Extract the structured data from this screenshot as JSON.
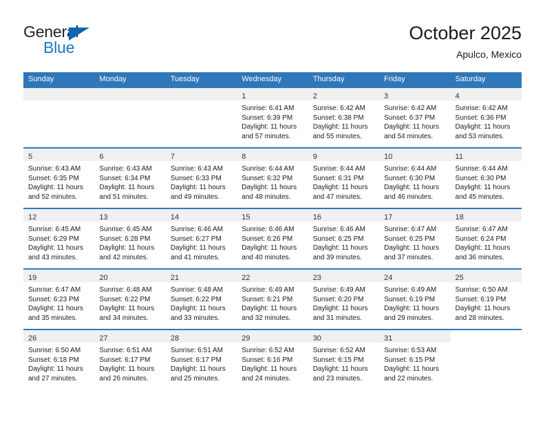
{
  "logo": {
    "word1": "General",
    "word2": "Blue",
    "triangle_color": "#0c68b4",
    "text_color": "#231f20",
    "blue_text_color": "#1878c8"
  },
  "header": {
    "title": "October 2025",
    "location": "Apulco, Mexico"
  },
  "theme": {
    "header_blue": "#2f77b8",
    "daynum_band": "#f0f0f0",
    "text": "#1a1a1a"
  },
  "weekdays": [
    "Sunday",
    "Monday",
    "Tuesday",
    "Wednesday",
    "Thursday",
    "Friday",
    "Saturday"
  ],
  "weeks": [
    [
      {
        "day": "",
        "sunrise": "",
        "sunset": "",
        "daylight1": "",
        "daylight2": "",
        "state": "empty"
      },
      {
        "day": "",
        "sunrise": "",
        "sunset": "",
        "daylight1": "",
        "daylight2": "",
        "state": "empty"
      },
      {
        "day": "",
        "sunrise": "",
        "sunset": "",
        "daylight1": "",
        "daylight2": "",
        "state": "empty"
      },
      {
        "day": "1",
        "sunrise": "Sunrise: 6:41 AM",
        "sunset": "Sunset: 6:39 PM",
        "daylight1": "Daylight: 11 hours",
        "daylight2": "and 57 minutes.",
        "state": "filled"
      },
      {
        "day": "2",
        "sunrise": "Sunrise: 6:42 AM",
        "sunset": "Sunset: 6:38 PM",
        "daylight1": "Daylight: 11 hours",
        "daylight2": "and 55 minutes.",
        "state": "filled"
      },
      {
        "day": "3",
        "sunrise": "Sunrise: 6:42 AM",
        "sunset": "Sunset: 6:37 PM",
        "daylight1": "Daylight: 11 hours",
        "daylight2": "and 54 minutes.",
        "state": "filled"
      },
      {
        "day": "4",
        "sunrise": "Sunrise: 6:42 AM",
        "sunset": "Sunset: 6:36 PM",
        "daylight1": "Daylight: 11 hours",
        "daylight2": "and 53 minutes.",
        "state": "filled"
      }
    ],
    [
      {
        "day": "5",
        "sunrise": "Sunrise: 6:43 AM",
        "sunset": "Sunset: 6:35 PM",
        "daylight1": "Daylight: 11 hours",
        "daylight2": "and 52 minutes.",
        "state": "filled"
      },
      {
        "day": "6",
        "sunrise": "Sunrise: 6:43 AM",
        "sunset": "Sunset: 6:34 PM",
        "daylight1": "Daylight: 11 hours",
        "daylight2": "and 51 minutes.",
        "state": "filled"
      },
      {
        "day": "7",
        "sunrise": "Sunrise: 6:43 AM",
        "sunset": "Sunset: 6:33 PM",
        "daylight1": "Daylight: 11 hours",
        "daylight2": "and 49 minutes.",
        "state": "filled"
      },
      {
        "day": "8",
        "sunrise": "Sunrise: 6:44 AM",
        "sunset": "Sunset: 6:32 PM",
        "daylight1": "Daylight: 11 hours",
        "daylight2": "and 48 minutes.",
        "state": "filled"
      },
      {
        "day": "9",
        "sunrise": "Sunrise: 6:44 AM",
        "sunset": "Sunset: 6:31 PM",
        "daylight1": "Daylight: 11 hours",
        "daylight2": "and 47 minutes.",
        "state": "filled"
      },
      {
        "day": "10",
        "sunrise": "Sunrise: 6:44 AM",
        "sunset": "Sunset: 6:30 PM",
        "daylight1": "Daylight: 11 hours",
        "daylight2": "and 46 minutes.",
        "state": "filled"
      },
      {
        "day": "11",
        "sunrise": "Sunrise: 6:44 AM",
        "sunset": "Sunset: 6:30 PM",
        "daylight1": "Daylight: 11 hours",
        "daylight2": "and 45 minutes.",
        "state": "filled"
      }
    ],
    [
      {
        "day": "12",
        "sunrise": "Sunrise: 6:45 AM",
        "sunset": "Sunset: 6:29 PM",
        "daylight1": "Daylight: 11 hours",
        "daylight2": "and 43 minutes.",
        "state": "filled"
      },
      {
        "day": "13",
        "sunrise": "Sunrise: 6:45 AM",
        "sunset": "Sunset: 6:28 PM",
        "daylight1": "Daylight: 11 hours",
        "daylight2": "and 42 minutes.",
        "state": "filled"
      },
      {
        "day": "14",
        "sunrise": "Sunrise: 6:46 AM",
        "sunset": "Sunset: 6:27 PM",
        "daylight1": "Daylight: 11 hours",
        "daylight2": "and 41 minutes.",
        "state": "filled"
      },
      {
        "day": "15",
        "sunrise": "Sunrise: 6:46 AM",
        "sunset": "Sunset: 6:26 PM",
        "daylight1": "Daylight: 11 hours",
        "daylight2": "and 40 minutes.",
        "state": "filled"
      },
      {
        "day": "16",
        "sunrise": "Sunrise: 6:46 AM",
        "sunset": "Sunset: 6:25 PM",
        "daylight1": "Daylight: 11 hours",
        "daylight2": "and 39 minutes.",
        "state": "filled"
      },
      {
        "day": "17",
        "sunrise": "Sunrise: 6:47 AM",
        "sunset": "Sunset: 6:25 PM",
        "daylight1": "Daylight: 11 hours",
        "daylight2": "and 37 minutes.",
        "state": "filled"
      },
      {
        "day": "18",
        "sunrise": "Sunrise: 6:47 AM",
        "sunset": "Sunset: 6:24 PM",
        "daylight1": "Daylight: 11 hours",
        "daylight2": "and 36 minutes.",
        "state": "filled"
      }
    ],
    [
      {
        "day": "19",
        "sunrise": "Sunrise: 6:47 AM",
        "sunset": "Sunset: 6:23 PM",
        "daylight1": "Daylight: 11 hours",
        "daylight2": "and 35 minutes.",
        "state": "filled"
      },
      {
        "day": "20",
        "sunrise": "Sunrise: 6:48 AM",
        "sunset": "Sunset: 6:22 PM",
        "daylight1": "Daylight: 11 hours",
        "daylight2": "and 34 minutes.",
        "state": "filled"
      },
      {
        "day": "21",
        "sunrise": "Sunrise: 6:48 AM",
        "sunset": "Sunset: 6:22 PM",
        "daylight1": "Daylight: 11 hours",
        "daylight2": "and 33 minutes.",
        "state": "filled"
      },
      {
        "day": "22",
        "sunrise": "Sunrise: 6:49 AM",
        "sunset": "Sunset: 6:21 PM",
        "daylight1": "Daylight: 11 hours",
        "daylight2": "and 32 minutes.",
        "state": "filled"
      },
      {
        "day": "23",
        "sunrise": "Sunrise: 6:49 AM",
        "sunset": "Sunset: 6:20 PM",
        "daylight1": "Daylight: 11 hours",
        "daylight2": "and 31 minutes.",
        "state": "filled"
      },
      {
        "day": "24",
        "sunrise": "Sunrise: 6:49 AM",
        "sunset": "Sunset: 6:19 PM",
        "daylight1": "Daylight: 11 hours",
        "daylight2": "and 29 minutes.",
        "state": "filled"
      },
      {
        "day": "25",
        "sunrise": "Sunrise: 6:50 AM",
        "sunset": "Sunset: 6:19 PM",
        "daylight1": "Daylight: 11 hours",
        "daylight2": "and 28 minutes.",
        "state": "filled"
      }
    ],
    [
      {
        "day": "26",
        "sunrise": "Sunrise: 6:50 AM",
        "sunset": "Sunset: 6:18 PM",
        "daylight1": "Daylight: 11 hours",
        "daylight2": "and 27 minutes.",
        "state": "filled"
      },
      {
        "day": "27",
        "sunrise": "Sunrise: 6:51 AM",
        "sunset": "Sunset: 6:17 PM",
        "daylight1": "Daylight: 11 hours",
        "daylight2": "and 26 minutes.",
        "state": "filled"
      },
      {
        "day": "28",
        "sunrise": "Sunrise: 6:51 AM",
        "sunset": "Sunset: 6:17 PM",
        "daylight1": "Daylight: 11 hours",
        "daylight2": "and 25 minutes.",
        "state": "filled"
      },
      {
        "day": "29",
        "sunrise": "Sunrise: 6:52 AM",
        "sunset": "Sunset: 6:16 PM",
        "daylight1": "Daylight: 11 hours",
        "daylight2": "and 24 minutes.",
        "state": "filled"
      },
      {
        "day": "30",
        "sunrise": "Sunrise: 6:52 AM",
        "sunset": "Sunset: 6:15 PM",
        "daylight1": "Daylight: 11 hours",
        "daylight2": "and 23 minutes.",
        "state": "filled"
      },
      {
        "day": "31",
        "sunrise": "Sunrise: 6:53 AM",
        "sunset": "Sunset: 6:15 PM",
        "daylight1": "Daylight: 11 hours",
        "daylight2": "and 22 minutes.",
        "state": "filled"
      },
      {
        "day": "",
        "sunrise": "",
        "sunset": "",
        "daylight1": "",
        "daylight2": "",
        "state": "blank"
      }
    ]
  ]
}
